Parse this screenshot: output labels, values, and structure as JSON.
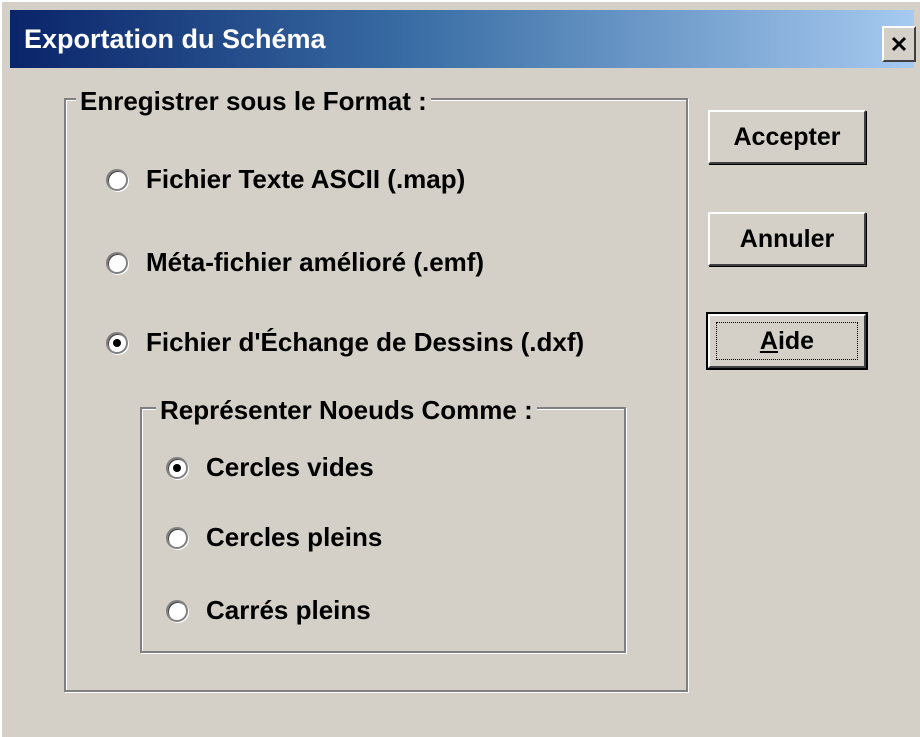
{
  "window": {
    "title": "Exportation du Schéma",
    "close_icon": "close-icon"
  },
  "format_group": {
    "legend": "Enregistrer sous le Format :",
    "options": [
      {
        "label": "Fichier Texte ASCII (.map)",
        "selected": false
      },
      {
        "label": "Méta-fichier amélioré (.emf)",
        "selected": false
      },
      {
        "label": "Fichier d'Échange de Dessins (.dxf)",
        "selected": true
      }
    ]
  },
  "nodes_group": {
    "legend": "Représenter Noeuds Comme :",
    "options": [
      {
        "label": "Cercles vides",
        "selected": true
      },
      {
        "label": "Cercles pleins",
        "selected": false
      },
      {
        "label": "Carrés pleins",
        "selected": false
      }
    ]
  },
  "buttons": {
    "accept": "Accepter",
    "cancel": "Annuler",
    "help": "Aide"
  },
  "colors": {
    "dialog_bg": "#d4d0c8",
    "title_start": "#0a246a",
    "title_end": "#a6caf0"
  }
}
